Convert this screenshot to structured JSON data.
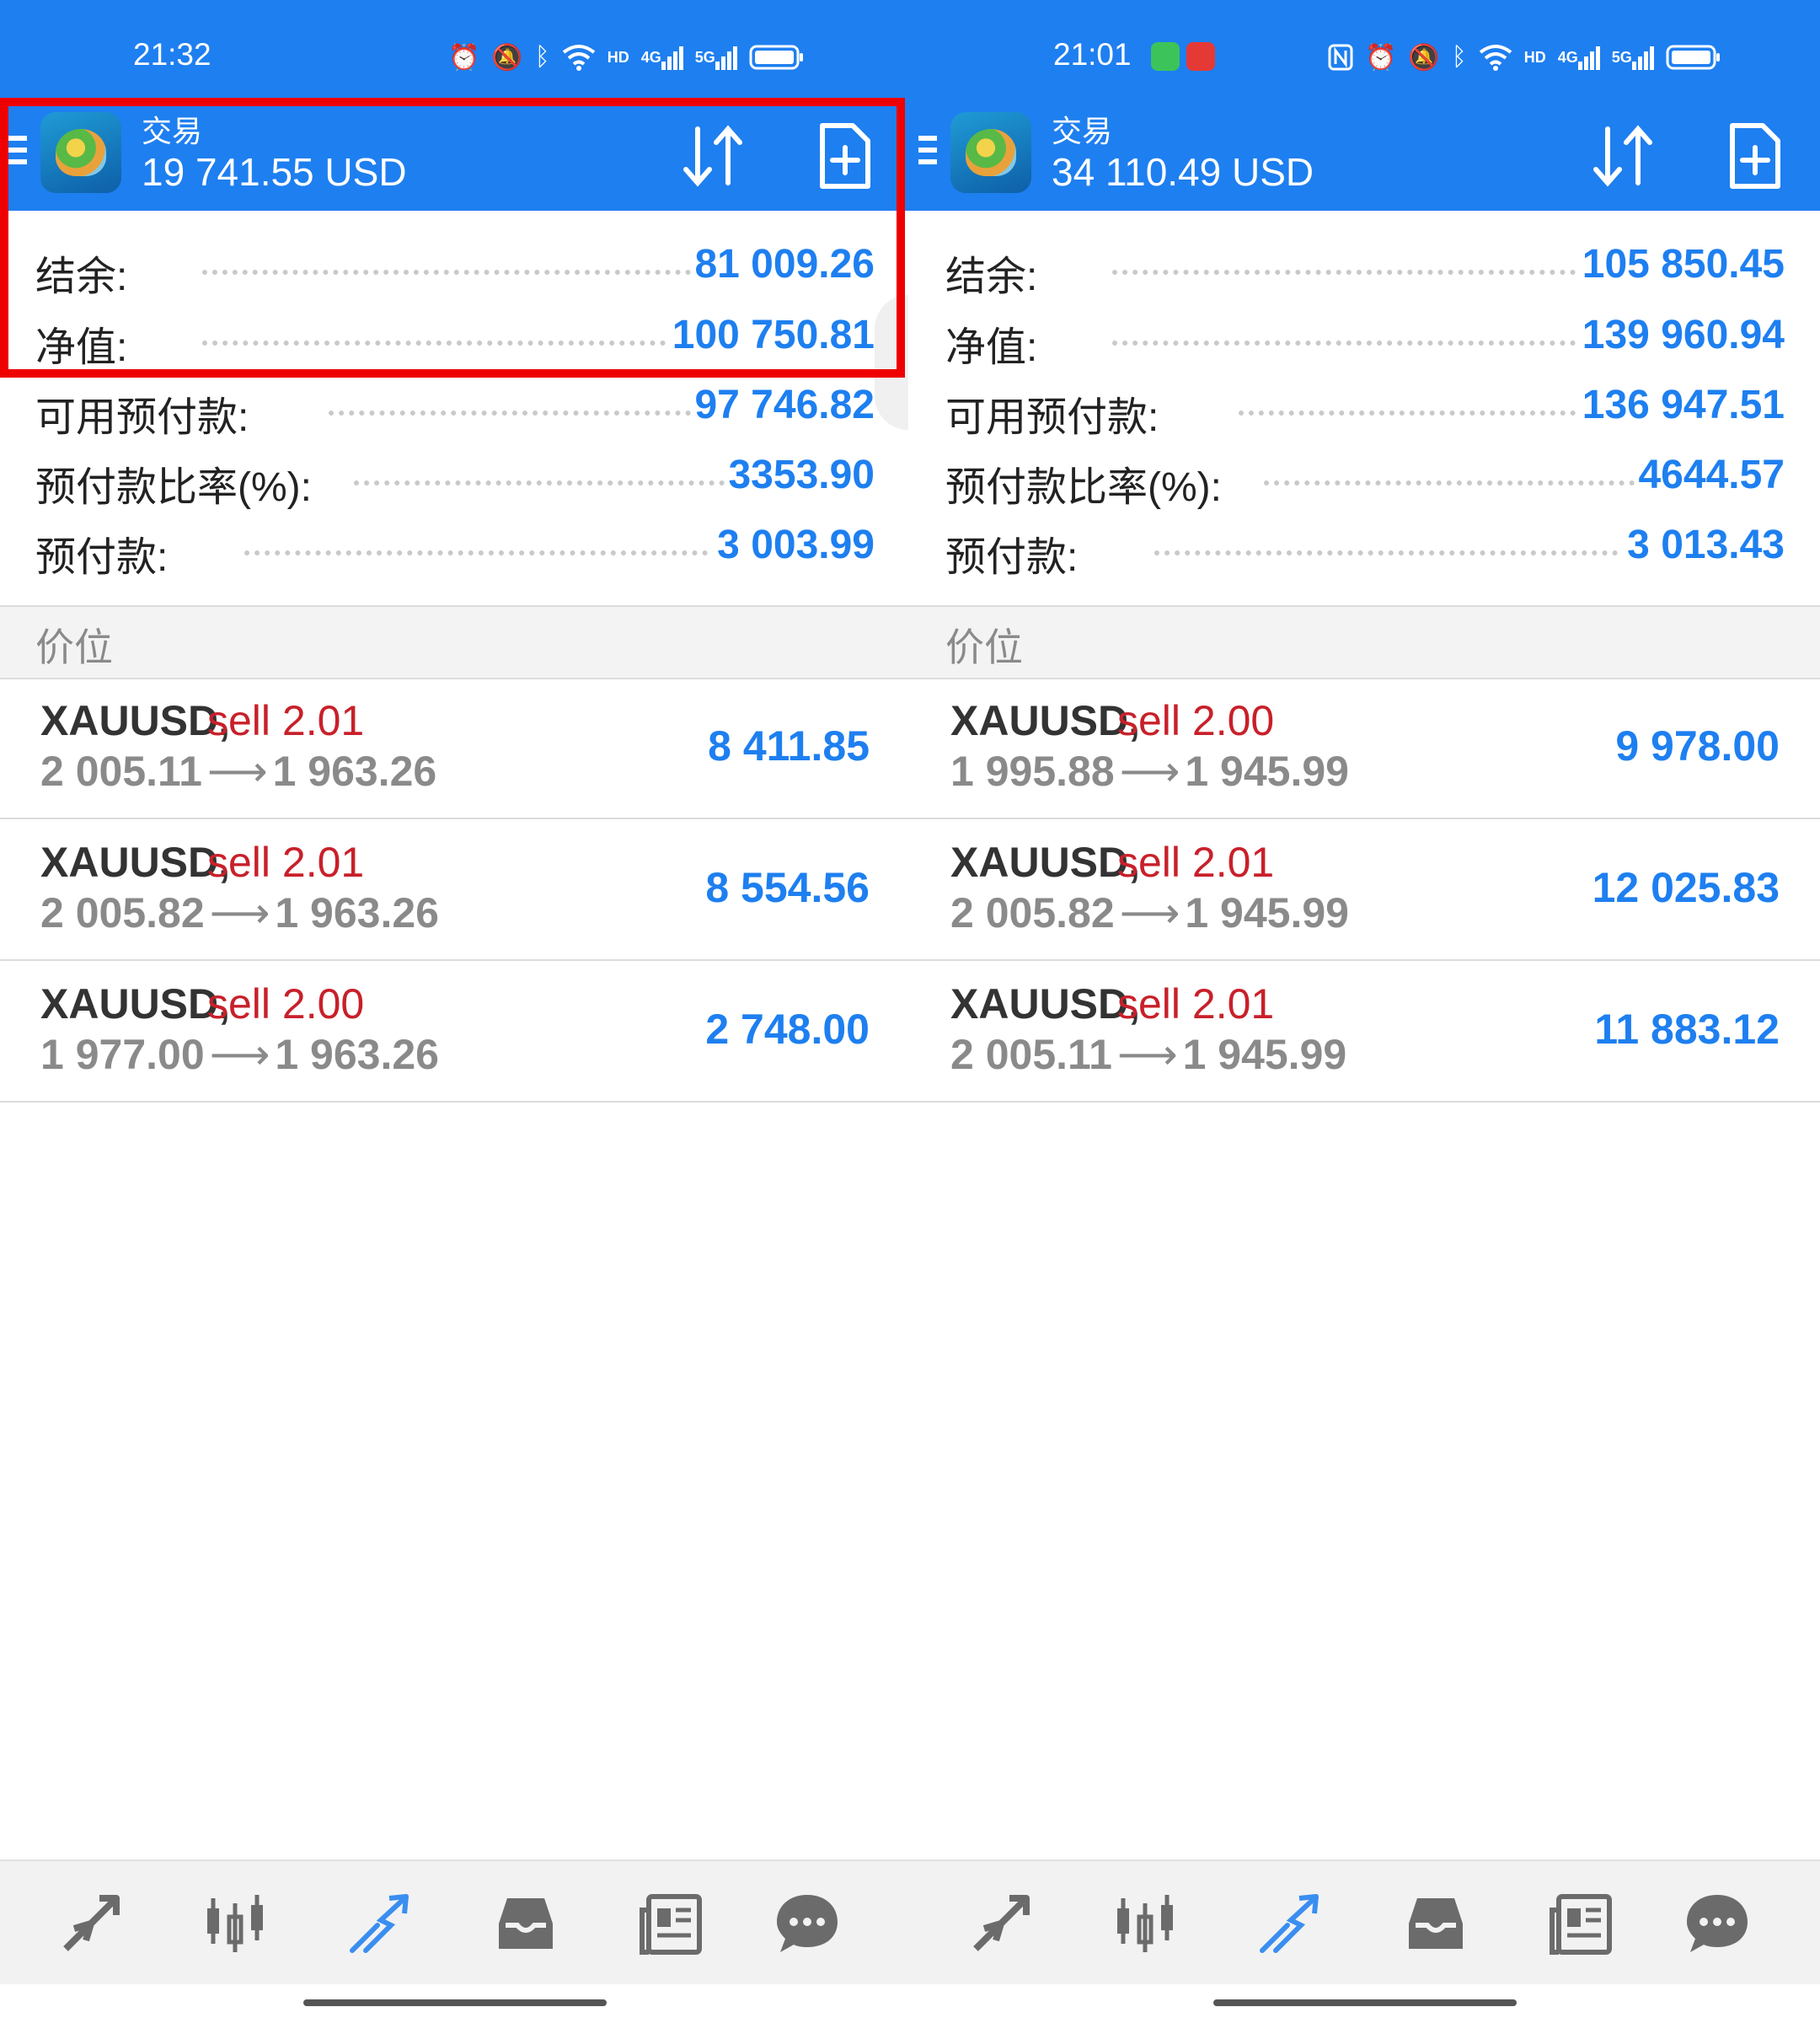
{
  "panels": [
    {
      "status_time": "21:32",
      "title": "交易",
      "balance": "19 741.55 USD",
      "summary": [
        {
          "label": "结余:",
          "value": "81 009.26"
        },
        {
          "label": "净值:",
          "value": "100 750.81"
        },
        {
          "label": "可用预付款:",
          "value": "97 746.82"
        },
        {
          "label": "预付款比率(%):",
          "value": "3353.90"
        },
        {
          "label": "预付款:",
          "value": "3 003.99"
        }
      ],
      "section": "价位",
      "positions": [
        {
          "symbol": "XAUUSD,",
          "side": "sell 2.01",
          "open": "2 005.11",
          "current": "1 963.26",
          "profit": "8 411.85"
        },
        {
          "symbol": "XAUUSD,",
          "side": "sell 2.01",
          "open": "2 005.82",
          "current": "1 963.26",
          "profit": "8 554.56"
        },
        {
          "symbol": "XAUUSD,",
          "side": "sell 2.00",
          "open": "1 977.00",
          "current": "1 963.26",
          "profit": "2 748.00"
        }
      ]
    },
    {
      "status_time": "21:01",
      "title": "交易",
      "balance": "34 110.49 USD",
      "summary": [
        {
          "label": "结余:",
          "value": "105 850.45"
        },
        {
          "label": "净值:",
          "value": "139 960.94"
        },
        {
          "label": "可用预付款:",
          "value": "136 947.51"
        },
        {
          "label": "预付款比率(%):",
          "value": "4644.57"
        },
        {
          "label": "预付款:",
          "value": "3 013.43"
        }
      ],
      "section": "价位",
      "positions": [
        {
          "symbol": "XAUUSD,",
          "side": "sell 2.00",
          "open": "1 995.88",
          "current": "1 945.99",
          "profit": "9 978.00"
        },
        {
          "symbol": "XAUUSD,",
          "side": "sell 2.01",
          "open": "2 005.82",
          "current": "1 945.99",
          "profit": "12 025.83"
        },
        {
          "symbol": "XAUUSD,",
          "side": "sell 2.01",
          "open": "2 005.11",
          "current": "1 945.99",
          "profit": "11 883.12"
        }
      ]
    }
  ],
  "status_icons": {
    "hd_label": "HD",
    "net4g": "4G",
    "net5g": "5G"
  },
  "colors": {
    "accent": "#1e7ff0",
    "sell": "#c8202a",
    "highlight": "#ee0000"
  },
  "nav_items": [
    "quotes-icon",
    "chart-icon",
    "trade-icon",
    "history-icon",
    "news-icon",
    "chat-icon"
  ]
}
